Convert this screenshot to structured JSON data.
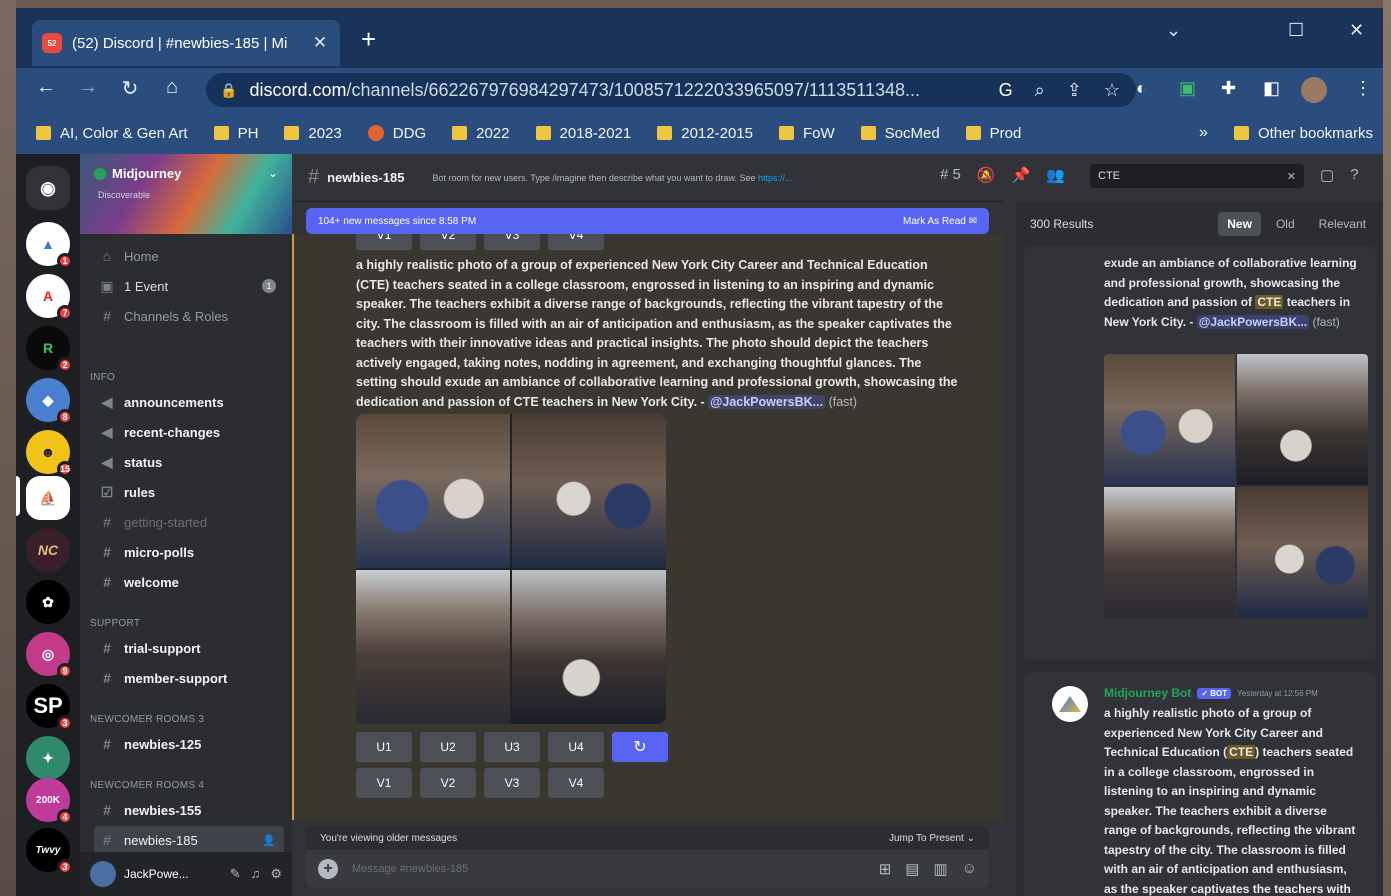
{
  "browser": {
    "tab_title": "(52) Discord | #newbies-185 | Mi",
    "tab_favicon_text": "52",
    "url_host": "discord.com",
    "url_path": "/channels/662267976984297473/1008571222033965097/1113511348...",
    "bookmarks": [
      "AI, Color & Gen Art",
      "PH",
      "2023",
      "DDG",
      "2022",
      "2018-2021",
      "2012-2015",
      "FoW",
      "SocMed",
      "Prod"
    ],
    "other_bookmarks": "Other bookmarks",
    "more_bookmarks": "»"
  },
  "server": {
    "name": "Midjourney",
    "sub": "Discoverable"
  },
  "server_list": {
    "badges": [
      "1",
      "7",
      "2",
      "8",
      "15",
      "9",
      "3",
      "4",
      "3"
    ],
    "labels": [
      "SP",
      "200K",
      "Twvy"
    ]
  },
  "channels": {
    "home": "Home",
    "event": "1 Event",
    "event_count": "1",
    "channels_roles": "Channels & Roles",
    "cat_info": "INFO",
    "announcements": "announcements",
    "recent_changes": "recent-changes",
    "status": "status",
    "rules": "rules",
    "getting_started": "getting-started",
    "micro_polls": "micro-polls",
    "welcome": "welcome",
    "cat_support": "SUPPORT",
    "trial_support": "trial-support",
    "member_support": "member-support",
    "cat_newcomer3": "NEWCOMER ROOMS 3",
    "newbies_125": "newbies-125",
    "cat_newcomer4": "NEWCOMER ROOMS 4",
    "newbies_155": "newbies-155",
    "newbies_185": "newbies-185"
  },
  "user": {
    "name": "JackPowe..."
  },
  "chat": {
    "channel": "newbies-185",
    "topic": "Bot room for new users. Type /imagine then describe what you want to draw. See",
    "topic_link": "https://...",
    "threads_count": "5",
    "new_messages": "104+ new messages since 8:58 PM",
    "mark_read": "Mark As Read",
    "prompt": "a highly realistic photo of a group of experienced New York City Career and Technical Education (CTE) teachers seated in a college classroom, engrossed in listening to an inspiring and dynamic speaker. The teachers exhibit a diverse range of backgrounds, reflecting the vibrant tapestry of the city. The classroom is filled with an air of anticipation and enthusiasm, as the speaker captivates the teachers with their innovative ideas and practical insights. The photo should depict the teachers actively engaged, taking notes, nodding in agreement, and exchanging thoughtful glances. The setting should exude an ambiance of collaborative learning and professional growth, showcasing the dedication and passion of CTE teachers in New York City. -",
    "mention": "@JackPowersBK...",
    "fast": "(fast)",
    "top_buttons": [
      "V1",
      "V2",
      "V3",
      "V4"
    ],
    "u_buttons": [
      "U1",
      "U2",
      "U3",
      "U4"
    ],
    "v_buttons": [
      "V1",
      "V2",
      "V3",
      "V4"
    ],
    "refresh": "↻",
    "older": "You're viewing older messages",
    "jump": "Jump To Present",
    "composer_placeholder": "Message #newbies-185"
  },
  "search": {
    "query": "CTE",
    "results_count": "300 Results",
    "tabs": [
      "New",
      "Old",
      "Relevant"
    ],
    "snippet_prefix": "exude an ambiance of collaborative learning and professional growth, showcasing the dedication and passion of",
    "snippet_hl": "CTE",
    "snippet_suffix": "teachers in New York City. -",
    "snippet_mention": "@JackPowersBK...",
    "snippet_fast": "(fast)",
    "bot_name": "Midjourney Bot",
    "bot_tag": "✓ BOT",
    "bot_time": "Yesterday at 12:56 PM",
    "bot_text_a": "a highly realistic photo of a group of experienced New York City Career and Technical Education (",
    "bot_text_hl": "CTE",
    "bot_text_b": ") teachers seated in a college classroom, engrossed in listening to an inspiring and dynamic speaker. The teachers exhibit a diverse range of backgrounds, reflecting the vibrant tapestry of the city. The classroom is filled with an air of anticipation and enthusiasm, as the speaker captivates the teachers with their innovative ideas and practical"
  }
}
